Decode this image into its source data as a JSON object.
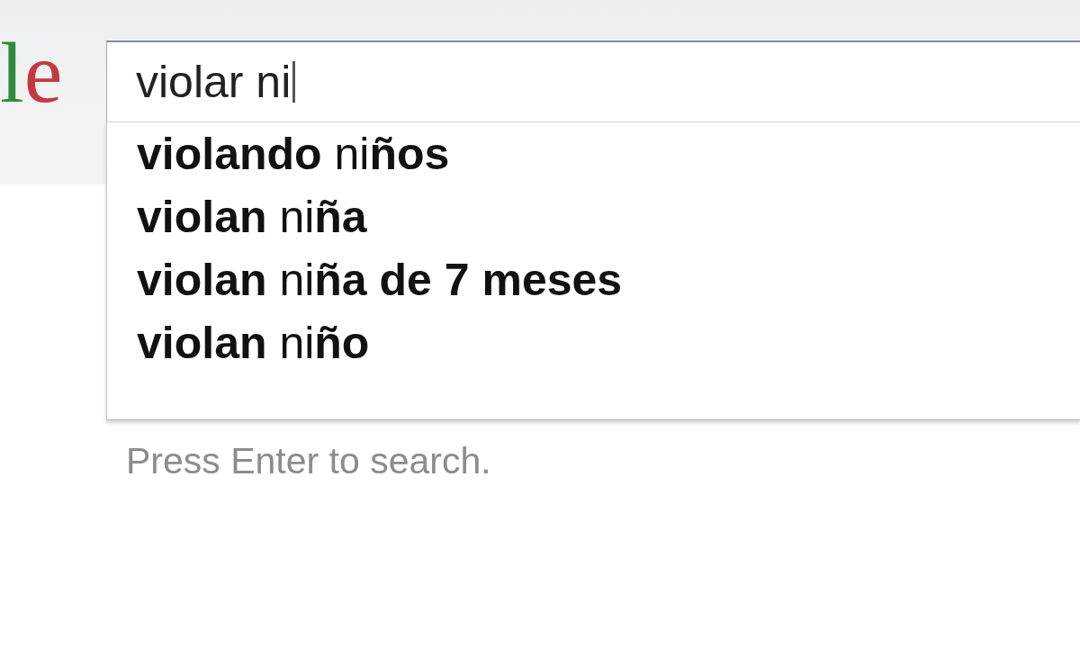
{
  "logo": {
    "letters": [
      {
        "text": "l",
        "color": "#2f8b3c"
      },
      {
        "text": "e",
        "color": "#c23a40"
      }
    ]
  },
  "search": {
    "value": "violar ni"
  },
  "suggestions": [
    {
      "text": "**violando** ni**ños**",
      "selected": false
    },
    {
      "text": "**violan** ni**ña**",
      "selected": false
    },
    {
      "text": "**violan** ni**ña de 7 meses**",
      "selected": false
    },
    {
      "text": "**violan** ni**ño**",
      "selected": false
    }
  ],
  "hint": "Press Enter to search."
}
